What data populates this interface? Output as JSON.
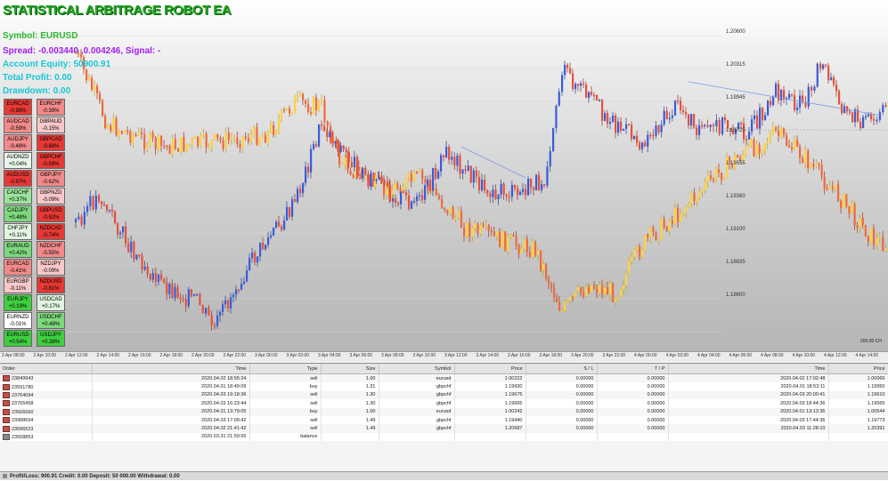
{
  "robot": {
    "title": "STATISTICAL ARBITRAGE ROBOT EA",
    "symbol_line": "Symbol: EURUSD",
    "spread_line": "Spread: -0.003440 ,0.004246, Signal: -",
    "equity_line": "Account Equity: 50900.91",
    "profit_line": "Total Profit: 0.00",
    "drawdown_line": "Drawdown: 0.00",
    "colors": {
      "symbol": "#2fb82f",
      "spread": "#a020f0",
      "equity": "#19c6d6",
      "profit": "#19c6d6",
      "drawdown": "#19c6d6"
    }
  },
  "ratio_cells": [
    {
      "pair": "EURCAD",
      "value": "-0.99%",
      "color": "#e53935",
      "col": 0,
      "row": 0
    },
    {
      "pair": "EURCHF",
      "value": "-0.39%",
      "color": "#f28a8a",
      "col": 1,
      "row": 0
    },
    {
      "pair": "AUDCAD",
      "value": "-0.59%",
      "color": "#f28a8a",
      "col": 0,
      "row": 1
    },
    {
      "pair": "GBPAUD",
      "value": "-0.15%",
      "color": "#f8c8c8",
      "col": 1,
      "row": 1
    },
    {
      "pair": "AUDJPY",
      "value": "-0.48%",
      "color": "#f28a8a",
      "col": 0,
      "row": 2
    },
    {
      "pair": "GBPCAD",
      "value": "-0.88%",
      "color": "#e53935",
      "col": 1,
      "row": 2
    },
    {
      "pair": "AUDNZD",
      "value": "+0.04%",
      "color": "#e8f5e8",
      "col": 0,
      "row": 3
    },
    {
      "pair": "GBPCHF",
      "value": "-0.59%",
      "color": "#e53935",
      "col": 1,
      "row": 3
    },
    {
      "pair": "AUDUSD",
      "value": "-0.97%",
      "color": "#e53935",
      "col": 0,
      "row": 4
    },
    {
      "pair": "GBPJPY",
      "value": "-0.62%",
      "color": "#f28a8a",
      "col": 1,
      "row": 4
    },
    {
      "pair": "CADCHF",
      "value": "+0.37%",
      "color": "#9be39b",
      "col": 0,
      "row": 5
    },
    {
      "pair": "GBPNZD",
      "value": "-0.09%",
      "color": "#f8c8c8",
      "col": 1,
      "row": 5
    },
    {
      "pair": "CADJPY",
      "value": "+0.48%",
      "color": "#7ed87e",
      "col": 0,
      "row": 6
    },
    {
      "pair": "GBPUSD",
      "value": "-0.92%",
      "color": "#e53935",
      "col": 1,
      "row": 6
    },
    {
      "pair": "CHFJPY",
      "value": "+0.11%",
      "color": "#e0f5e0",
      "col": 0,
      "row": 7
    },
    {
      "pair": "NZDCAD",
      "value": "-0.74%",
      "color": "#e53935",
      "col": 1,
      "row": 7
    },
    {
      "pair": "EURAUD",
      "value": "+0.42%",
      "color": "#7ed87e",
      "col": 0,
      "row": 8
    },
    {
      "pair": "NZDCHF",
      "value": "-0.55%",
      "color": "#f28a8a",
      "col": 1,
      "row": 8
    },
    {
      "pair": "EURCAD",
      "value": "-0.41%",
      "color": "#f28a8a",
      "col": 0,
      "row": 9
    },
    {
      "pair": "NZDJPY",
      "value": "-0.09%",
      "color": "#f8c8c8",
      "col": 1,
      "row": 9
    },
    {
      "pair": "EURGBP",
      "value": "-0.11%",
      "color": "#f8c8c8",
      "col": 0,
      "row": 10
    },
    {
      "pair": "NZDUSD",
      "value": "-0.81%",
      "color": "#e53935",
      "col": 1,
      "row": 10
    },
    {
      "pair": "EURJPY",
      "value": "+0.19%",
      "color": "#3fcf3f",
      "col": 0,
      "row": 11
    },
    {
      "pair": "USDCAD",
      "value": "+0.17%",
      "color": "#e0f5e0",
      "col": 1,
      "row": 11
    },
    {
      "pair": "EURNZD",
      "value": "-0.01%",
      "color": "#ffffff",
      "col": 0,
      "row": 12
    },
    {
      "pair": "USDCHF",
      "value": "+0.48%",
      "color": "#7ed87e",
      "col": 1,
      "row": 12
    },
    {
      "pair": "EURUSD",
      "value": "+0.54%",
      "color": "#3fcf3f",
      "col": 0,
      "row": 13
    },
    {
      "pair": "USDJPY",
      "value": "+0.38%",
      "color": "#3fcf3f",
      "col": 1,
      "row": 13
    }
  ],
  "price_axis": {
    "labels": [
      "1.20600",
      "1.20315",
      "1.19945",
      "1.19725",
      "1.19555",
      "1.19360",
      "1.19100",
      "1.18835",
      "1.18600"
    ],
    "corner": "200.00 CH"
  },
  "time_axis": {
    "labels": [
      "2 Apr 08:00",
      "2 Apr 10:00",
      "2 Apr 12:00",
      "2 Apr 14:00",
      "2 Apr 16:00",
      "2 Apr 18:00",
      "2 Apr 20:00",
      "2 Apr 22:00",
      "3 Apr 00:00",
      "3 Apr 02:00",
      "3 Apr 04:00",
      "3 Apr 06:00",
      "3 Apr 08:00",
      "3 Apr 10:00",
      "3 Apr 12:00",
      "3 Apr 14:00",
      "3 Apr 16:00",
      "3 Apr 18:00",
      "3 Apr 20:00",
      "3 Apr 22:00",
      "4 Apr 00:00",
      "4 Apr 02:00",
      "4 Apr 04:00",
      "4 Apr 06:00",
      "4 Apr 08:00",
      "4 Apr 10:00",
      "4 Apr 12:00",
      "4 Apr 14:00"
    ]
  },
  "terminal": {
    "columns": [
      "Order",
      "Time",
      "Type",
      "Size",
      "Symbol",
      "Price",
      "S / L",
      "T / P",
      "Time",
      "Price"
    ],
    "rows": [
      [
        "23849943",
        "2020.04.02 18:55:24",
        "sell",
        "1.00",
        "eurusd",
        "1.00222",
        "0.00000",
        "0.00000",
        "2020.04.02 17:02:48",
        "1.00066"
      ],
      [
        "23591780",
        "2020.04.01 18:49:09",
        "buy",
        "1.31",
        "gbpchf",
        "1.19930",
        "0.00000",
        "0.00000",
        "2020.04.01 18:53:11",
        "1.19950"
      ],
      [
        "23764094",
        "2020.04.03 19:18:36",
        "sell",
        "1.30",
        "gbpchf",
        "1.19675",
        "0.00000",
        "0.00000",
        "2020.04.03 20:00:41",
        "1.19610"
      ],
      [
        "23765458",
        "2020.04.03 16:23:44",
        "sell",
        "1.30",
        "gbpchf",
        "1.19665",
        "0.00000",
        "0.00000",
        "2020.04.03 18:44:36",
        "1.19565"
      ],
      [
        "23566560",
        "2020.04.01 13:79:05",
        "buy",
        "1.00",
        "eurusd",
        "1.00242",
        "0.00000",
        "0.00000",
        "2020.04.01 13:13:36",
        "1.00544"
      ],
      [
        "23988694",
        "2020.04.03 17:09:42",
        "sell",
        "1.49",
        "gbpchf",
        "1.19440",
        "0.00000",
        "0.00000",
        "2020.04.03 17:44:36",
        "1.19773"
      ],
      [
        "23696523",
        "2020.04.02 21:41:42",
        "sell",
        "1.49",
        "gbpchf",
        "1.20687",
        "0.00000",
        "0.00000",
        "2020.04.03 11:28:10",
        "1.20391"
      ],
      [
        "23558853",
        "2020.03.31 21:59:55",
        "balance",
        "",
        "",
        "",
        "",
        "",
        "",
        ""
      ]
    ],
    "summary": "Profit/Loss: 900.91  Credit: 0.00  Deposit: 50 000.00  Withdrawal: 0.00"
  }
}
